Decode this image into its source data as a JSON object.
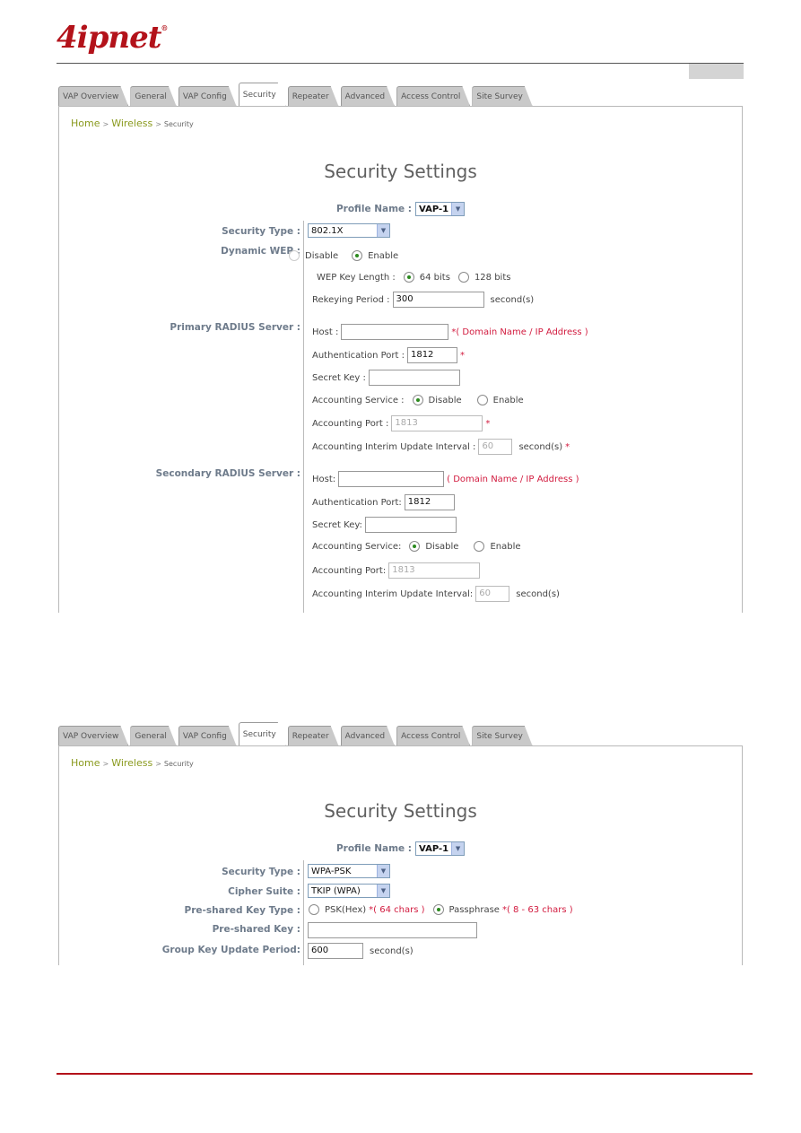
{
  "header": {
    "logo_text": "4ipnet",
    "logo_mark": "®",
    "brand_color": "#b3121a"
  },
  "tabs": [
    {
      "label": "VAP Overview"
    },
    {
      "label": "General"
    },
    {
      "label": "VAP Config"
    },
    {
      "label": "Security"
    },
    {
      "label": "Repeater"
    },
    {
      "label": "Advanced"
    },
    {
      "label": "Access Control"
    },
    {
      "label": "Site Survey"
    }
  ],
  "breadcrumb": {
    "home": "Home",
    "wireless": "Wireless",
    "current": "Security",
    "separator": ">"
  },
  "screen1": {
    "title": "Security Settings",
    "profile_name_label": "Profile Name :",
    "profile_name_value": "VAP-1",
    "security_type_label": "Security Type :",
    "security_type_value": "802.1X",
    "dynamic_wep_label": "Dynamic WEP :",
    "dynamic_wep_options": {
      "disable": "Disable",
      "enable": "Enable",
      "selected": "Enable"
    },
    "wep_key_length_label": "WEP Key Length :",
    "wep_key_length_options": {
      "a": "64 bits",
      "b": "128 bits",
      "selected": "64 bits"
    },
    "rekeying_label": "Rekeying Period :",
    "rekeying_value": "300",
    "rekeying_unit": "second(s)",
    "primary": {
      "label": "Primary RADIUS Server :",
      "host_label": "Host :",
      "host_value": "",
      "host_hint": "*( Domain Name / IP Address )",
      "auth_port_label": "Authentication Port :",
      "auth_port_value": "1812",
      "auth_port_req": "*",
      "secret_label": "Secret Key :",
      "secret_value": "",
      "acct_service_label": "Accounting Service :",
      "acct_disable": "Disable",
      "acct_enable": "Enable",
      "acct_selected": "Disable",
      "acct_port_label": "Accounting Port :",
      "acct_port_value": "1813",
      "acct_port_req": "*",
      "interim_label": "Accounting Interim Update Interval :",
      "interim_value": "60",
      "interim_unit": "second(s)",
      "interim_req": "*"
    },
    "secondary": {
      "label": "Secondary RADIUS Server :",
      "host_label": "Host:",
      "host_value": "",
      "host_hint": "( Domain Name / IP Address )",
      "auth_port_label": "Authentication Port:",
      "auth_port_value": "1812",
      "secret_label": "Secret Key:",
      "secret_value": "",
      "acct_service_label": "Accounting Service:",
      "acct_disable": "Disable",
      "acct_enable": "Enable",
      "acct_selected": "Disable",
      "acct_port_label": "Accounting Port:",
      "acct_port_value": "1813",
      "interim_label": "Accounting Interim Update Interval:",
      "interim_value": "60",
      "interim_unit": "second(s)"
    }
  },
  "screen2": {
    "title": "Security Settings",
    "profile_name_label": "Profile Name :",
    "profile_name_value": "VAP-1",
    "security_type_label": "Security Type :",
    "security_type_value": "WPA-PSK",
    "cipher_label": "Cipher Suite :",
    "cipher_value": "TKIP (WPA)",
    "psk_type_label": "Pre-shared Key Type :",
    "psk_hex": "PSK(Hex)",
    "psk_hex_hint": "*( 64 chars )",
    "passphrase": "Passphrase",
    "passphrase_hint": "*( 8 - 63 chars )",
    "psk_selected": "Passphrase",
    "psk_label": "Pre-shared Key :",
    "psk_value": "",
    "group_key_label": "Group Key Update Period:",
    "group_key_value": "600",
    "group_key_unit": "second(s)"
  }
}
